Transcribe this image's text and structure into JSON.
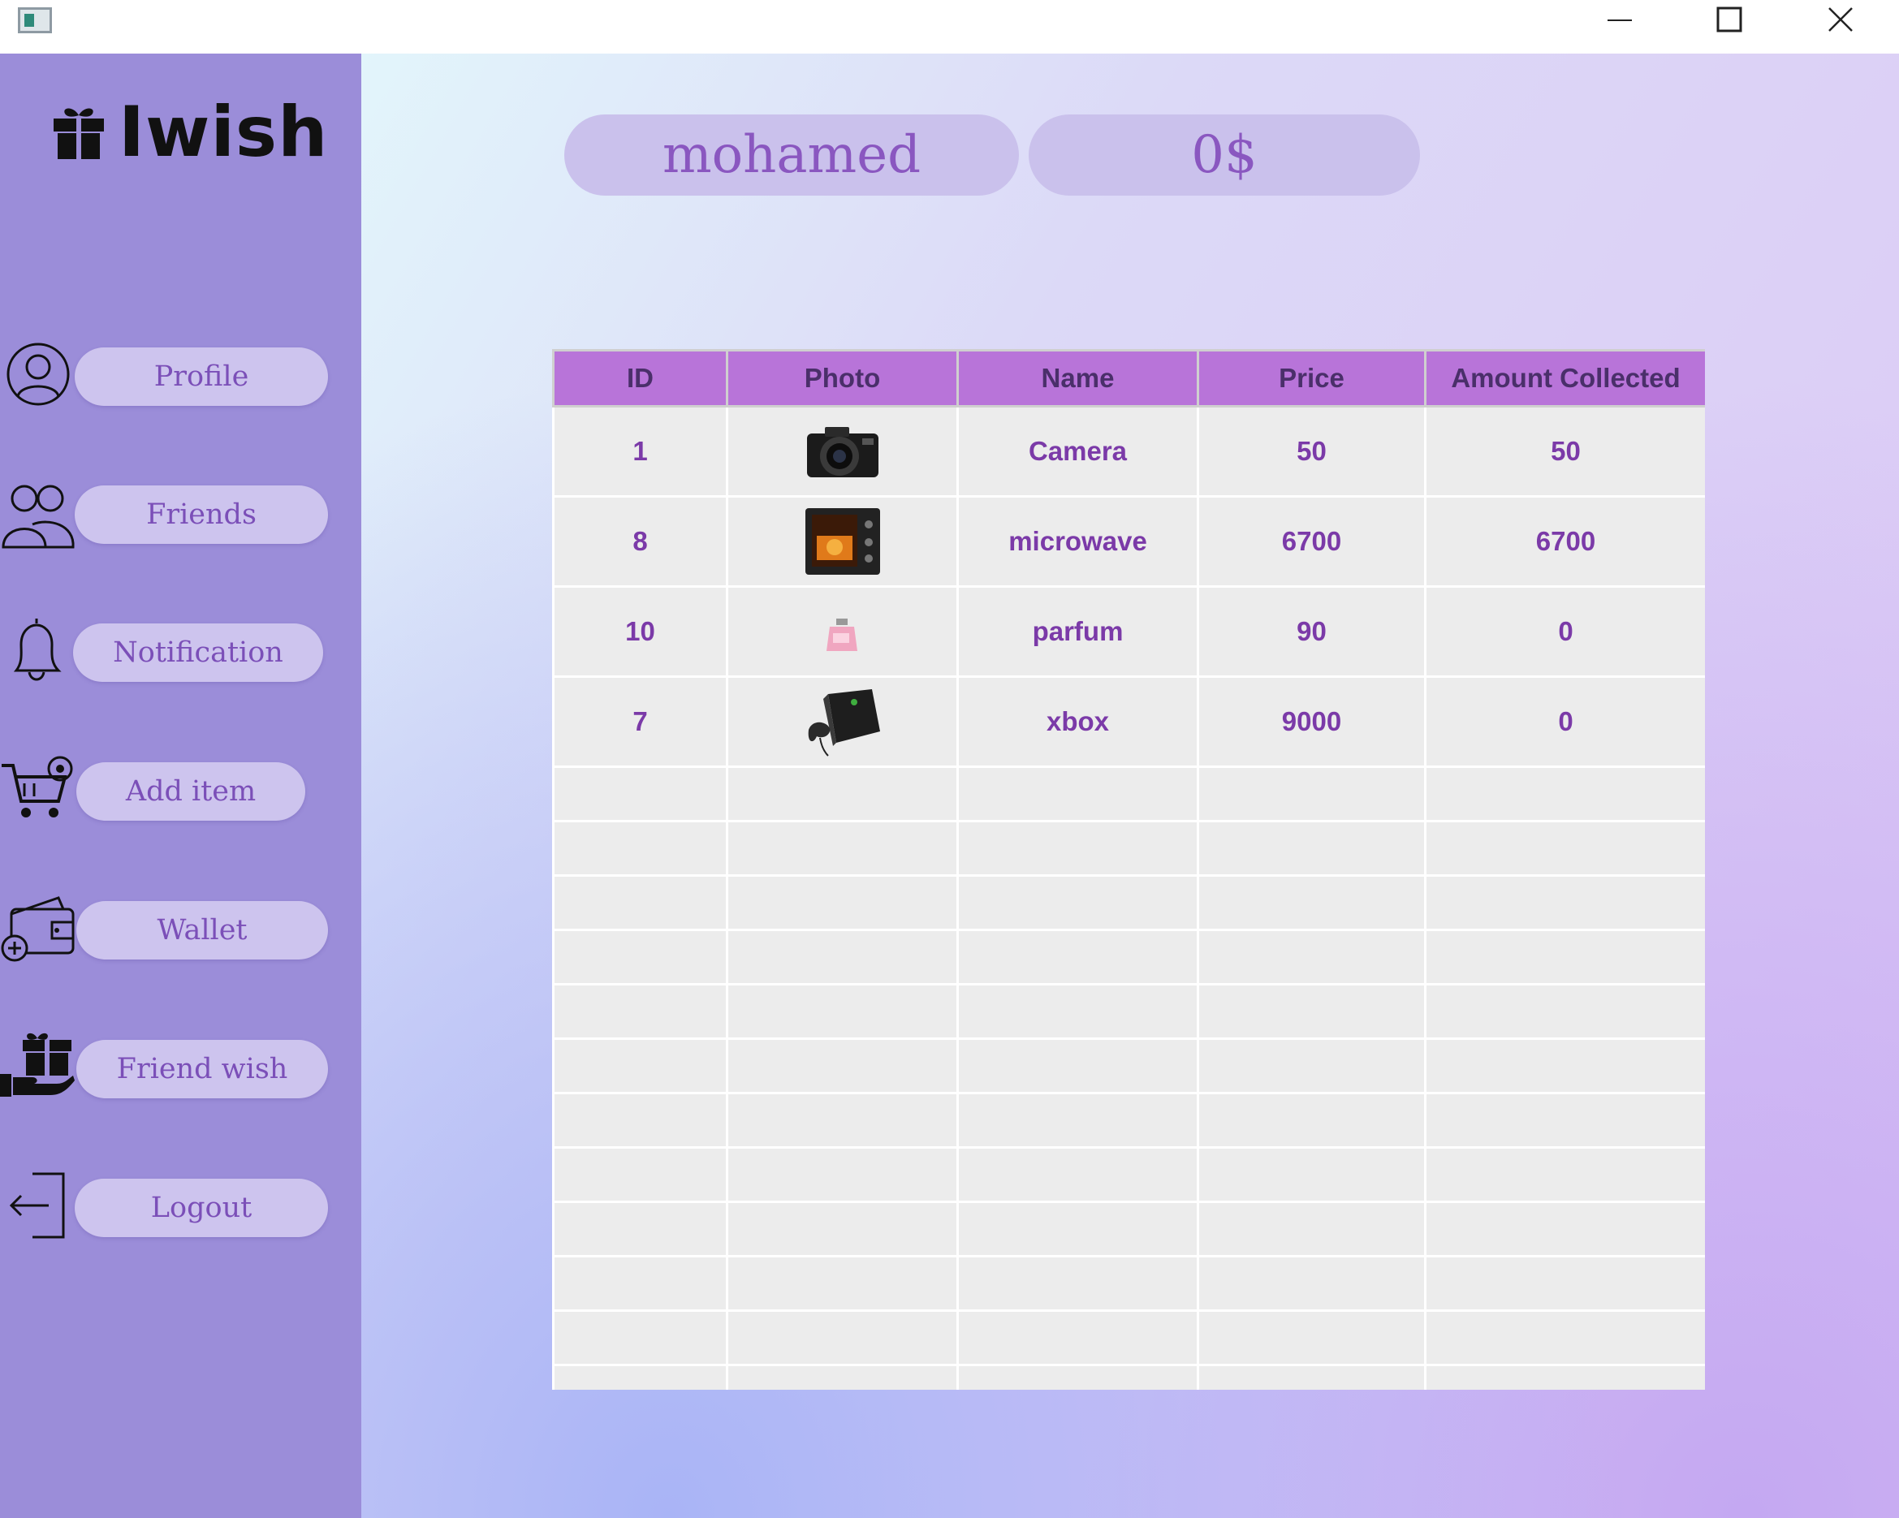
{
  "window": {
    "icon": "app-window-icon",
    "controls": [
      "minimize-icon",
      "maximize-icon",
      "close-icon"
    ]
  },
  "sidebar": {
    "logo_text": "Iwish",
    "logo_icon": "gift-icon",
    "items": [
      {
        "label": "Profile",
        "icon": "user-circle-icon"
      },
      {
        "label": "Friends",
        "icon": "users-icon"
      },
      {
        "label": "Notification",
        "icon": "bell-icon"
      },
      {
        "label": "Add item",
        "icon": "cart-add-icon"
      },
      {
        "label": "Wallet",
        "icon": "wallet-add-icon"
      },
      {
        "label": "Friend wish",
        "icon": "hand-gift-icon"
      },
      {
        "label": "Logout",
        "icon": "logout-icon"
      }
    ]
  },
  "header": {
    "username": "mohamed",
    "balance": "0$"
  },
  "table": {
    "columns": [
      "ID",
      "Photo",
      "Name",
      "Price",
      "Amount Collected"
    ],
    "rows": [
      {
        "id": "1",
        "photo": "camera-photo",
        "name": "Camera",
        "price": "50",
        "amount_collected": "50"
      },
      {
        "id": "8",
        "photo": "microwave-photo",
        "name": "microwave",
        "price": "6700",
        "amount_collected": "6700"
      },
      {
        "id": "10",
        "photo": "parfum-photo",
        "name": "parfum",
        "price": "90",
        "amount_collected": "0"
      },
      {
        "id": "7",
        "photo": "xbox-photo",
        "name": "xbox",
        "price": "9000",
        "amount_collected": "0"
      }
    ]
  },
  "colors": {
    "sidebar": "#9b8dd9",
    "pill": "#cdc4ee",
    "table_header": "#b874d9",
    "accent_text": "#7b3aa8"
  }
}
